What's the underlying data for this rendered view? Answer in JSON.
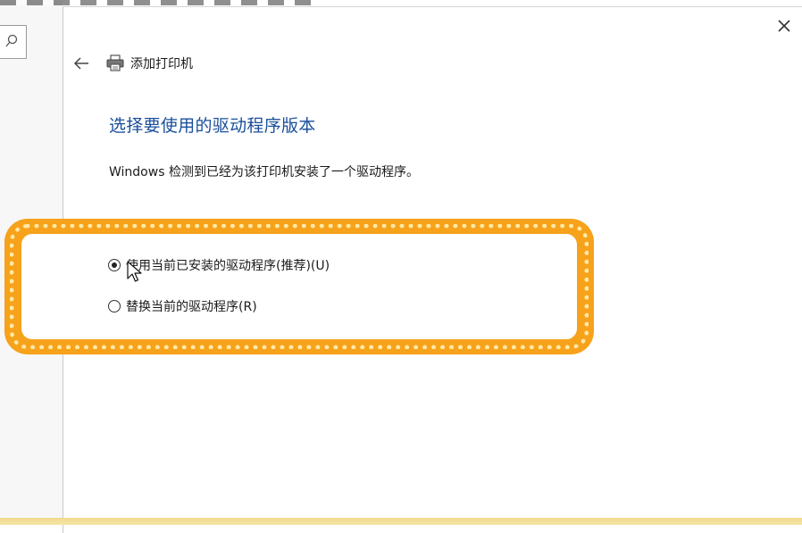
{
  "dialog": {
    "title": "添加打印机",
    "heading": "选择要使用的驱动程序版本",
    "description": "Windows 检测到已经为该打印机安装了一个驱动程序。",
    "close_symbol": "✕"
  },
  "options": [
    {
      "label": "使用当前已安装的驱动程序(推荐)(U)",
      "selected": true
    },
    {
      "label": "替换当前的驱动程序(R)",
      "selected": false
    }
  ],
  "colors": {
    "heading": "#1a4f9c",
    "highlight": "#f7a21b",
    "highlight_dots": "#ffe9a6"
  },
  "icons": [
    "search-icon",
    "back-arrow-icon",
    "printer-icon",
    "close-icon",
    "mouse-cursor-icon"
  ]
}
